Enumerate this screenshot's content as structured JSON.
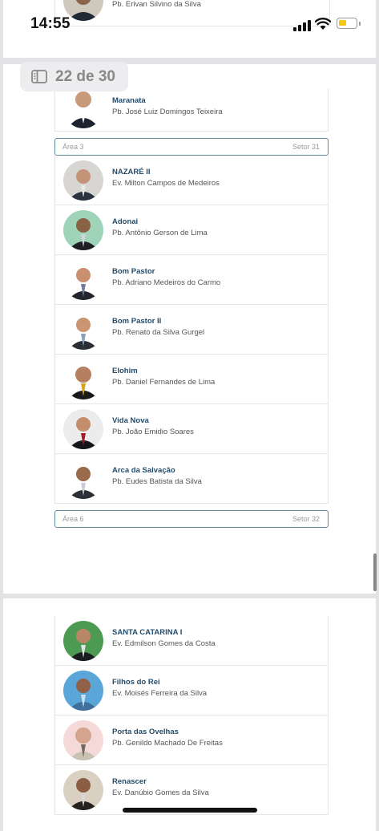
{
  "status_bar": {
    "time": "14:55"
  },
  "page_indicator": {
    "label": "22 de 30"
  },
  "top_partial": {
    "pastor": "Pb. Erivan Silvino da Silva"
  },
  "first_partial": {
    "name": "Maranata",
    "pastor": "Pb. José Luiz Domingos Teixeira"
  },
  "section_a": {
    "area": "Área 3",
    "setor": "Setor 31"
  },
  "churches_a": [
    {
      "name": "NAZARÉ II",
      "pastor": "Ev. Milton Campos de Medeiros"
    },
    {
      "name": "Adonai",
      "pastor": "Pb. Antônio Gerson de Lima"
    },
    {
      "name": "Bom Pastor",
      "pastor": "Pb. Adriano Medeiros do Carmo"
    },
    {
      "name": "Bom Pastor II",
      "pastor": "Pb. Renato da Silva Gurgel"
    },
    {
      "name": "Elohim",
      "pastor": "Pb. Daniel Fernandes de Lima"
    },
    {
      "name": "Vida Nova",
      "pastor": "Pb. João Emidio Soares"
    },
    {
      "name": "Arca da Salvação",
      "pastor": "Pb. Eudes Batista da Silva"
    }
  ],
  "section_b": {
    "area": "Área 6",
    "setor": "Setor 32"
  },
  "churches_b": [
    {
      "name": "SANTA CATARINA I",
      "pastor": "Ev. Edmilson Gomes da Costa"
    },
    {
      "name": "Filhos do Rei",
      "pastor": "Ev. Moisés Ferreira da Silva"
    },
    {
      "name": "Porta das Ovelhas",
      "pastor": "Pb. Genildo Machado De Freitas"
    },
    {
      "name": "Renascer",
      "pastor": "Ev. Danúbio Gomes da Silva"
    }
  ],
  "colors": {
    "accent": "#234c6b",
    "section_border": "#5f8ba0",
    "battery": "#f5c518"
  }
}
